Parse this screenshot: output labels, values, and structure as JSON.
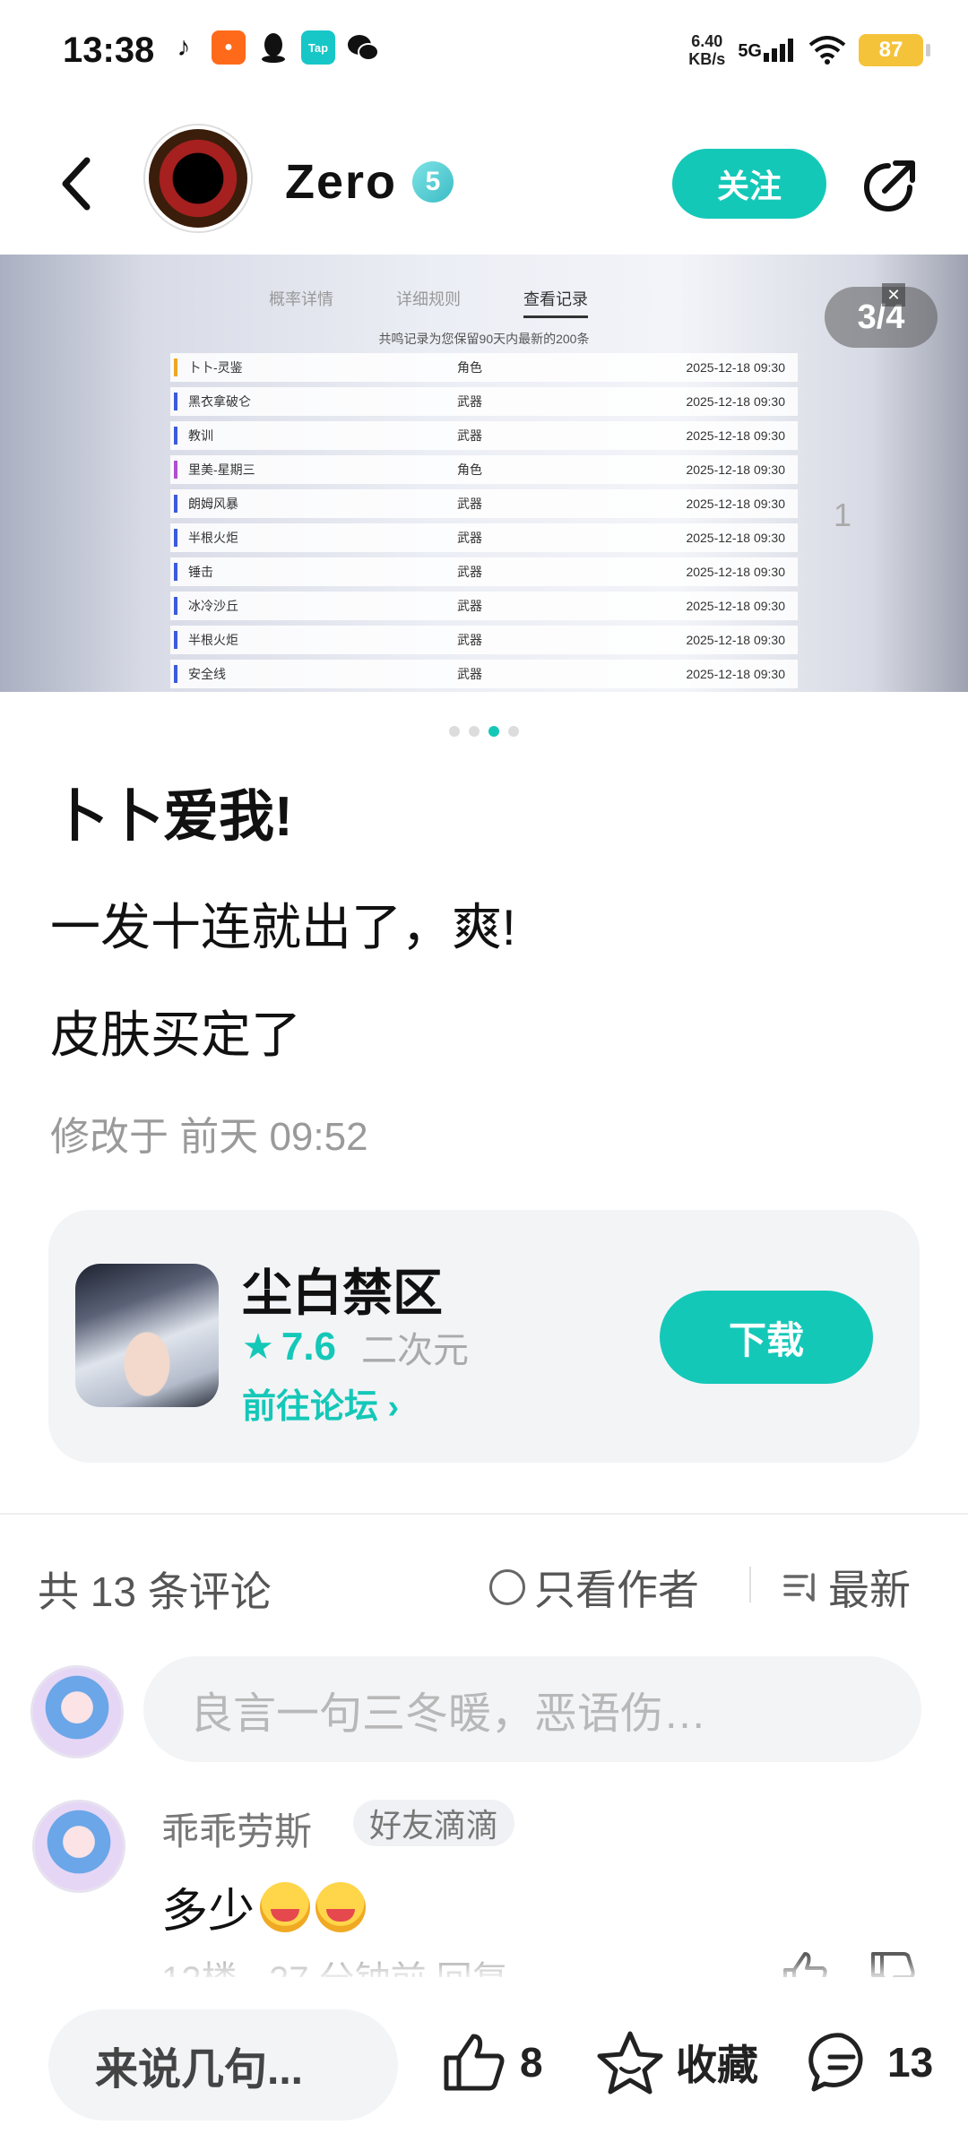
{
  "status": {
    "time": "13:38",
    "net_speed_value": "6.40",
    "net_speed_unit": "KB/s",
    "network": "5G",
    "battery": "87",
    "app_icons": [
      "tiktok-icon",
      "kuaishou-icon",
      "qq-icon",
      "taptap-icon",
      "wechat-icon"
    ]
  },
  "header": {
    "author_name": "Zero",
    "author_level": "5",
    "follow_label": "关注"
  },
  "carousel": {
    "page_counter": "3/4",
    "side_number": "1",
    "tabs": [
      "概率详情",
      "详细规则",
      "查看记录"
    ],
    "note": "共鸣记录为您保留90天内最新的200条",
    "close_glyph": "✕",
    "rows": [
      {
        "name": "卜卜-灵鉴",
        "type": "角色",
        "time": "2025-12-18 09:30",
        "color": "#f0a623"
      },
      {
        "name": "黑衣拿破仑",
        "type": "武器",
        "time": "2025-12-18 09:30",
        "color": "#3b5bdb"
      },
      {
        "name": "教训",
        "type": "武器",
        "time": "2025-12-18 09:30",
        "color": "#3b5bdb"
      },
      {
        "name": "里美-星期三",
        "type": "角色",
        "time": "2025-12-18 09:30",
        "color": "#b04fcf"
      },
      {
        "name": "朗姆风暴",
        "type": "武器",
        "time": "2025-12-18 09:30",
        "color": "#3b5bdb"
      },
      {
        "name": "半根火炬",
        "type": "武器",
        "time": "2025-12-18 09:30",
        "color": "#3b5bdb"
      },
      {
        "name": "锤击",
        "type": "武器",
        "time": "2025-12-18 09:30",
        "color": "#3b5bdb"
      },
      {
        "name": "冰冷沙丘",
        "type": "武器",
        "time": "2025-12-18 09:30",
        "color": "#3b5bdb"
      },
      {
        "name": "半根火炬",
        "type": "武器",
        "time": "2025-12-18 09:30",
        "color": "#3b5bdb"
      },
      {
        "name": "安全线",
        "type": "武器",
        "time": "2025-12-18 09:30",
        "color": "#3b5bdb"
      }
    ]
  },
  "post": {
    "title": "卜卜爱我!",
    "line1": "一发十连就出了，爽!",
    "line2": "皮肤买定了",
    "modified": "修改于 前天 09:52"
  },
  "game": {
    "name": "尘白禁区",
    "star": "★",
    "rating": "7.6",
    "tag": "二次元",
    "forum_link": "前往论坛 ›",
    "download_label": "下载"
  },
  "comments": {
    "count_label": "共 13 条评论",
    "author_only_label": "只看作者",
    "sort_label": "最新",
    "input_placeholder": "良言一句三冬暖，恶语伤…",
    "items": [
      {
        "name": "乖乖劳斯",
        "badge": "好友滴滴",
        "text": "多少",
        "meta": "12楼 · 27 分钟前  回复"
      }
    ]
  },
  "bottom_bar": {
    "reply_placeholder": "来说几句...",
    "like_count": "8",
    "favorite_label": "收藏",
    "comment_count": "13"
  },
  "colors": {
    "accent": "#14c8b8",
    "battery": "#f5c33a"
  }
}
